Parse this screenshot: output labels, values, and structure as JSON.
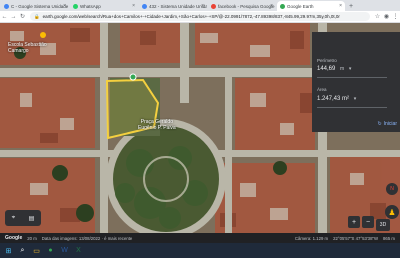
{
  "browser": {
    "tabs": [
      {
        "label": "C - Google Sistema Unidade",
        "favicon_color": "#4285f4",
        "active": false
      },
      {
        "label": "WhatsApp",
        "favicon_color": "#25d366",
        "active": false
      },
      {
        "label": "432 - Sistema Unidade Unida",
        "favicon_color": "#4285f4",
        "active": false
      },
      {
        "label": "facebook - Pesquisa Google",
        "favicon_color": "#ea4335",
        "active": false
      },
      {
        "label": "Google Earth",
        "favicon_color": "#34a853",
        "active": true
      }
    ],
    "url": "earth.google.com/web/search/Rua+dos+Camilos+-+Cidade+Jardim,+São+Carlos+-+SP/@-22.0991/7872,-47.89398/837,-845.99,29.97m,35y,0h,0t,0r",
    "nav_icons": {
      "back": "←",
      "forward": "→",
      "reload": "↻"
    },
    "new_tab": "+"
  },
  "map": {
    "labels": {
      "school_top": "Escola Sebastião",
      "school_sub": "Camargo",
      "plaza_line1": "Praça Geraldo",
      "plaza_line2": "Eugênio P. Paiva"
    },
    "colors": {
      "polygon": "#f4d03f",
      "roads": "#b9b6a8",
      "roofs": "#a8553c",
      "vegetation": "#3f5a2e"
    }
  },
  "measure_panel": {
    "perimeter_label": "Perímetro",
    "perimeter_value": "144,69",
    "perimeter_unit": "m",
    "area_label": "Área",
    "area_value": "1.247,43 m²",
    "area_unit": "",
    "unit_arrow": "▾",
    "start_button": "Iniciar",
    "start_icon": "↻"
  },
  "controls": {
    "location_icon": "⌖",
    "layers_icon": "▤",
    "compass_label": "N",
    "zoom_in": "+",
    "zoom_out": "−",
    "pegman": "♟",
    "view_3d": "3D"
  },
  "status_bar": {
    "google": "Google",
    "scale": "20 m",
    "imagery_date": "Data das imagens: 13/08/2022 · é mais recente",
    "camera": "Câmera: 1.129 m",
    "coords": "22°05'57\"S 47°53'38\"W",
    "altitude": "865 m"
  },
  "taskbar": {
    "items": [
      {
        "name": "windows",
        "glyph": "⊞",
        "color": "#4fc3f7"
      },
      {
        "name": "search",
        "glyph": "⌕",
        "color": "#ffffff"
      },
      {
        "name": "files",
        "glyph": "▭",
        "color": "#fbc02d"
      },
      {
        "name": "chrome",
        "glyph": "●",
        "color": "#34a853"
      },
      {
        "name": "word",
        "glyph": "W",
        "color": "#2b579a"
      },
      {
        "name": "excel",
        "glyph": "X",
        "color": "#217346"
      }
    ]
  }
}
